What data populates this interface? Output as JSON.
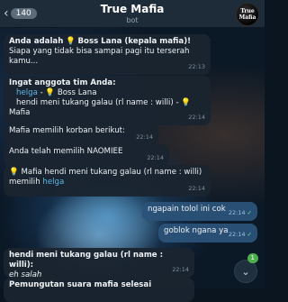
{
  "header": {
    "back_count": "140",
    "title": "True Mafia",
    "subtitle": "bot",
    "avatar_text": "True Mafia"
  },
  "messages": [
    {
      "line1": "Anda adalah",
      "icon": "bulb",
      "line1b": "Boss Lana (kepala mafia)!",
      "line2": "Siapa yang tidak bisa sampai pagi itu terserah",
      "line3": "kamu...",
      "time": "22:13"
    },
    {
      "line1": "Ingat anggota tim Anda:",
      "line2a": "helga",
      "line2b": "-",
      "line2c": "Boss Lana",
      "line3": "hendi meni tukang galau (rl name : willi) -",
      "line4": "Mafia",
      "time": "22:14"
    },
    {
      "text": "Mafia memilih korban berikut:",
      "time": "22:14"
    },
    {
      "text": "Anda telah memilih NAOMIEE",
      "time": "22:14"
    },
    {
      "line1": "Mafia hendi meni tukang galau (rl name : willi)",
      "line2a": "memilih",
      "line2b": "helga",
      "time": "22:14"
    }
  ],
  "outgoing": [
    {
      "text": "ngapain tolol ini cok",
      "time": "22:14",
      "status": "✓"
    },
    {
      "text": "goblok ngana ya",
      "time": "22:14",
      "status": "✓"
    }
  ],
  "last_messages": [
    {
      "sender": "hendi meni tukang galau (rl name : willi):",
      "text": "eh salah",
      "time": "22:14"
    },
    {
      "text": "Pemungutan suara mafia selesai"
    }
  ],
  "jump": {
    "badge": "1"
  },
  "colors": {
    "accent": "#5fb8e6",
    "header": "#1e2c3a",
    "bubble_in": "#1a2430",
    "bubble_out": "#2b5278"
  }
}
